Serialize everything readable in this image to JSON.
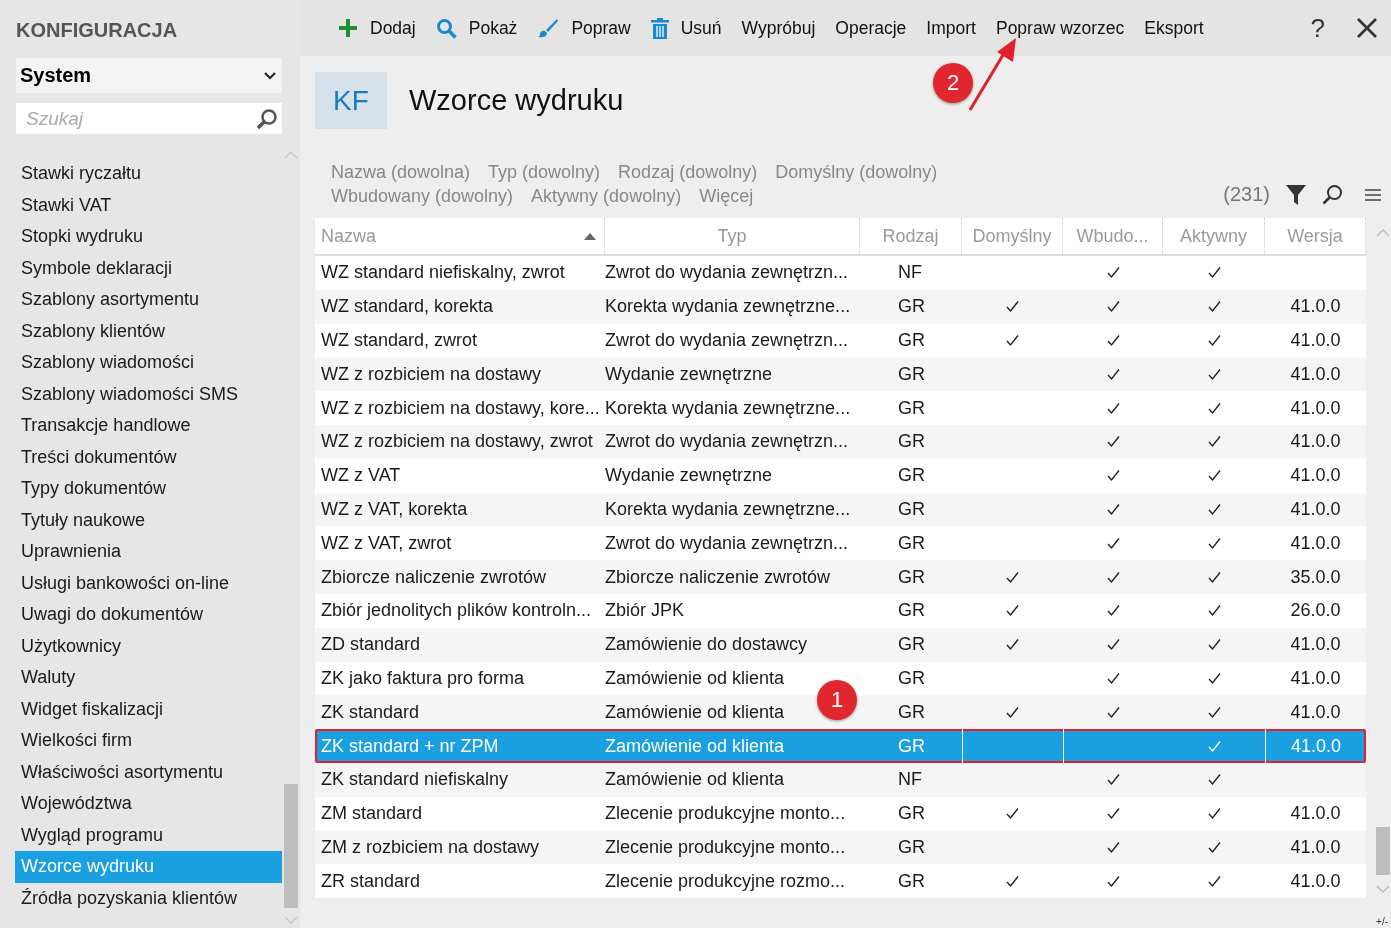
{
  "sidebar": {
    "title": "KONFIGURACJA",
    "section_select": {
      "value": "System"
    },
    "search": {
      "placeholder": "Szukaj"
    },
    "items": [
      {
        "label": "Stawki ryczałtu",
        "selected": false
      },
      {
        "label": "Stawki VAT",
        "selected": false
      },
      {
        "label": "Stopki wydruku",
        "selected": false
      },
      {
        "label": "Symbole deklaracji",
        "selected": false
      },
      {
        "label": "Szablony asortymentu",
        "selected": false
      },
      {
        "label": "Szablony klientów",
        "selected": false
      },
      {
        "label": "Szablony wiadomości",
        "selected": false
      },
      {
        "label": "Szablony wiadomości SMS",
        "selected": false
      },
      {
        "label": "Transakcje handlowe",
        "selected": false
      },
      {
        "label": "Treści dokumentów",
        "selected": false
      },
      {
        "label": "Typy dokumentów",
        "selected": false
      },
      {
        "label": "Tytuły naukowe",
        "selected": false
      },
      {
        "label": "Uprawnienia",
        "selected": false
      },
      {
        "label": "Usługi bankowości on-line",
        "selected": false
      },
      {
        "label": "Uwagi do dokumentów",
        "selected": false
      },
      {
        "label": "Użytkownicy",
        "selected": false
      },
      {
        "label": "Waluty",
        "selected": false
      },
      {
        "label": "Widget fiskalizacji",
        "selected": false
      },
      {
        "label": "Wielkości firm",
        "selected": false
      },
      {
        "label": "Właściwości asortymentu",
        "selected": false
      },
      {
        "label": "Województwa",
        "selected": false
      },
      {
        "label": "Wygląd programu",
        "selected": false
      },
      {
        "label": "Wzorce wydruku",
        "selected": true
      },
      {
        "label": "Źródła pozyskania klientów",
        "selected": false
      }
    ]
  },
  "toolbar": [
    "Dodaj",
    "Pokaż",
    "Popraw",
    "Usuń",
    "Wypróbuj",
    "Operacje",
    "Import",
    "Popraw wzorzec",
    "Eksport"
  ],
  "help": "?",
  "header": {
    "badge": "KF",
    "title": "Wzorce wydruku"
  },
  "filters": [
    [
      "Nazwa (dowolna)",
      "Typ (dowolny)",
      "Rodzaj (dowolny)",
      "Domyślny (dowolny)"
    ],
    [
      "Wbudowany (dowolny)",
      "Aktywny (dowolny)",
      "Więcej"
    ]
  ],
  "count": "(231)",
  "table": {
    "columns": [
      "Nazwa",
      "Typ",
      "Rodzaj",
      "Domyślny",
      "Wbudo...",
      "Aktywny",
      "Wersja"
    ],
    "rows": [
      {
        "nazwa": "WZ standard niefiskalny, zwrot",
        "typ": "Zwrot do wydania zewnętrzn...",
        "rodzaj": "NF",
        "domyslny": false,
        "wbudowany": true,
        "aktywny": true,
        "wersja": "",
        "selected": false
      },
      {
        "nazwa": "WZ standard, korekta",
        "typ": "Korekta wydania zewnętrzne...",
        "rodzaj": "GR",
        "domyslny": true,
        "wbudowany": true,
        "aktywny": true,
        "wersja": "41.0.0",
        "selected": false
      },
      {
        "nazwa": "WZ standard, zwrot",
        "typ": "Zwrot do wydania zewnętrzn...",
        "rodzaj": "GR",
        "domyslny": true,
        "wbudowany": true,
        "aktywny": true,
        "wersja": "41.0.0",
        "selected": false
      },
      {
        "nazwa": "WZ z rozbiciem na dostawy",
        "typ": "Wydanie zewnętrzne",
        "rodzaj": "GR",
        "domyslny": false,
        "wbudowany": true,
        "aktywny": true,
        "wersja": "41.0.0",
        "selected": false
      },
      {
        "nazwa": "WZ z rozbiciem na dostawy, kore...",
        "typ": "Korekta wydania zewnętrzne...",
        "rodzaj": "GR",
        "domyslny": false,
        "wbudowany": true,
        "aktywny": true,
        "wersja": "41.0.0",
        "selected": false
      },
      {
        "nazwa": "WZ z rozbiciem na dostawy, zwrot",
        "typ": "Zwrot do wydania zewnętrzn...",
        "rodzaj": "GR",
        "domyslny": false,
        "wbudowany": true,
        "aktywny": true,
        "wersja": "41.0.0",
        "selected": false
      },
      {
        "nazwa": "WZ z VAT",
        "typ": "Wydanie zewnętrzne",
        "rodzaj": "GR",
        "domyslny": false,
        "wbudowany": true,
        "aktywny": true,
        "wersja": "41.0.0",
        "selected": false
      },
      {
        "nazwa": "WZ z VAT, korekta",
        "typ": "Korekta wydania zewnętrzne...",
        "rodzaj": "GR",
        "domyslny": false,
        "wbudowany": true,
        "aktywny": true,
        "wersja": "41.0.0",
        "selected": false
      },
      {
        "nazwa": "WZ z VAT, zwrot",
        "typ": "Zwrot do wydania zewnętrzn...",
        "rodzaj": "GR",
        "domyslny": false,
        "wbudowany": true,
        "aktywny": true,
        "wersja": "41.0.0",
        "selected": false
      },
      {
        "nazwa": "Zbiorcze naliczenie zwrotów",
        "typ": "Zbiorcze naliczenie zwrotów",
        "rodzaj": "GR",
        "domyslny": true,
        "wbudowany": true,
        "aktywny": true,
        "wersja": "35.0.0",
        "selected": false
      },
      {
        "nazwa": "Zbiór jednolitych plików kontroln...",
        "typ": "Zbiór JPK",
        "rodzaj": "GR",
        "domyslny": true,
        "wbudowany": true,
        "aktywny": true,
        "wersja": "26.0.0",
        "selected": false
      },
      {
        "nazwa": "ZD standard",
        "typ": "Zamówienie do dostawcy",
        "rodzaj": "GR",
        "domyslny": true,
        "wbudowany": true,
        "aktywny": true,
        "wersja": "41.0.0",
        "selected": false
      },
      {
        "nazwa": "ZK jako faktura pro forma",
        "typ": "Zamówienie od klienta",
        "rodzaj": "GR",
        "domyslny": false,
        "wbudowany": true,
        "aktywny": true,
        "wersja": "41.0.0",
        "selected": false
      },
      {
        "nazwa": "ZK standard",
        "typ": "Zamówienie od klienta",
        "rodzaj": "GR",
        "domyslny": true,
        "wbudowany": true,
        "aktywny": true,
        "wersja": "41.0.0",
        "selected": false
      },
      {
        "nazwa": "ZK standard + nr ZPM",
        "typ": "Zamówienie od klienta",
        "rodzaj": "GR",
        "domyslny": false,
        "wbudowany": false,
        "aktywny": true,
        "wersja": "41.0.0",
        "selected": true
      },
      {
        "nazwa": "ZK standard niefiskalny",
        "typ": "Zamówienie od klienta",
        "rodzaj": "NF",
        "domyslny": false,
        "wbudowany": true,
        "aktywny": true,
        "wersja": "",
        "selected": false
      },
      {
        "nazwa": "ZM standard",
        "typ": "Zlecenie produkcyjne monto...",
        "rodzaj": "GR",
        "domyslny": true,
        "wbudowany": true,
        "aktywny": true,
        "wersja": "41.0.0",
        "selected": false
      },
      {
        "nazwa": "ZM z rozbiciem na dostawy",
        "typ": "Zlecenie produkcyjne monto...",
        "rodzaj": "GR",
        "domyslny": false,
        "wbudowany": true,
        "aktywny": true,
        "wersja": "41.0.0",
        "selected": false
      },
      {
        "nazwa": "ZR standard",
        "typ": "Zlecenie produkcyjne rozmo...",
        "rodzaj": "GR",
        "domyslny": true,
        "wbudowany": true,
        "aktywny": true,
        "wersja": "41.0.0",
        "selected": false
      }
    ]
  },
  "corner_label": "+/-",
  "annotations": [
    {
      "label": "1"
    },
    {
      "label": "2"
    }
  ]
}
